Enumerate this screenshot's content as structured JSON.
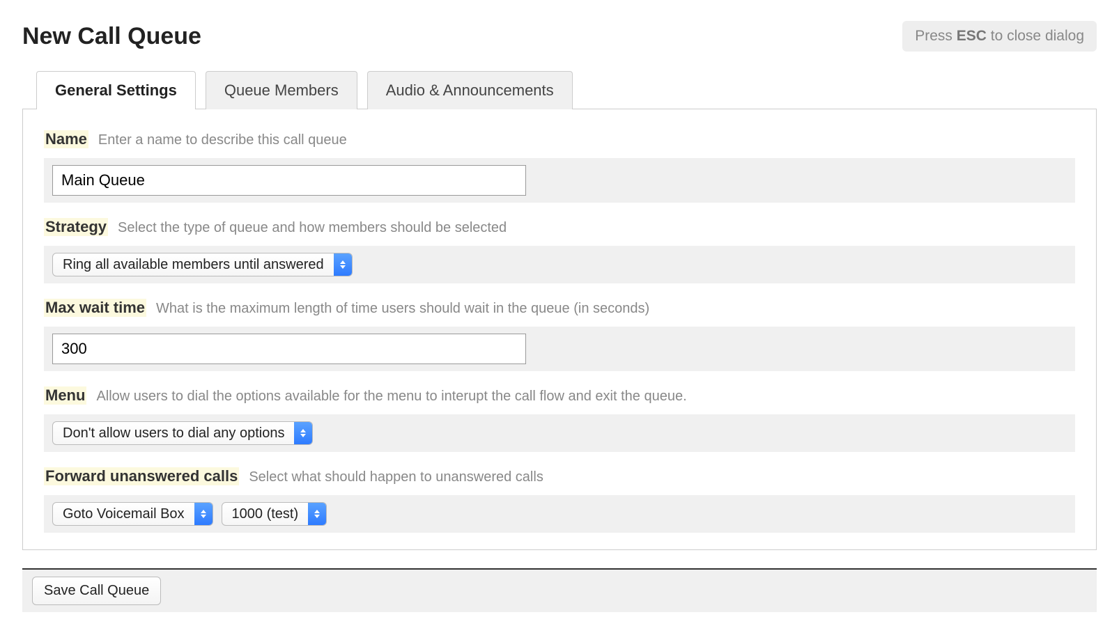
{
  "dialog": {
    "title": "New Call Queue",
    "esc_hint_prefix": "Press ",
    "esc_key": "ESC",
    "esc_hint_suffix": " to close dialog"
  },
  "tabs": {
    "general": "General Settings",
    "members": "Queue Members",
    "audio": "Audio & Announcements"
  },
  "fields": {
    "name": {
      "label": "Name",
      "desc": "Enter a name to describe this call queue",
      "value": "Main Queue"
    },
    "strategy": {
      "label": "Strategy",
      "desc": "Select the type of queue and how members should be selected",
      "selected": "Ring all available members until answered"
    },
    "max_wait": {
      "label": "Max wait time",
      "desc": "What is the maximum length of time users should wait in the queue (in seconds)",
      "value": "300"
    },
    "menu": {
      "label": "Menu",
      "desc": "Allow users to dial the options available for the menu to interupt the call flow and exit the queue.",
      "selected": "Don't allow users to dial any options"
    },
    "forward": {
      "label": "Forward unanswered calls",
      "desc": "Select what should happen to unanswered calls",
      "action_selected": "Goto Voicemail Box",
      "target_selected": "1000 (test)"
    }
  },
  "footer": {
    "save_label": "Save Call Queue"
  }
}
